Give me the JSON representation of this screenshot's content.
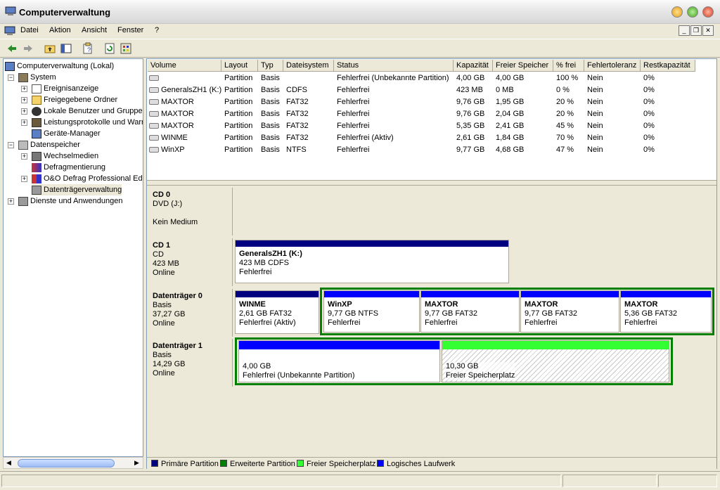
{
  "window": {
    "title": "Computerverwaltung"
  },
  "menu": [
    "Datei",
    "Aktion",
    "Ansicht",
    "Fenster",
    "?"
  ],
  "toolbar_icons": [
    "back-icon",
    "forward-icon",
    "up-folder-icon",
    "show-tree-icon",
    "properties-icon",
    "refresh-icon",
    "settings-icon"
  ],
  "tree": {
    "root": "Computerverwaltung (Lokal)",
    "system": "System",
    "system_items": [
      "Ereignisanzeige",
      "Freigegebene Ordner",
      "Lokale Benutzer und Gruppen",
      "Leistungsprotokolle und Warnungen",
      "Geräte-Manager"
    ],
    "storage": "Datenspeicher",
    "storage_items": [
      "Wechselmedien",
      "Defragmentierung",
      "O&O Defrag Professional Edition",
      "Datenträgerverwaltung"
    ],
    "services": "Dienste und Anwendungen"
  },
  "volumes": {
    "columns": [
      "Volume",
      "Layout",
      "Typ",
      "Dateisystem",
      "Status",
      "Kapazität",
      "Freier Speicher",
      "% frei",
      "Fehlertoleranz",
      "Restkapazität"
    ],
    "rows": [
      [
        "",
        "Partition",
        "Basis",
        "",
        "Fehlerfrei (Unbekannte Partition)",
        "4,00 GB",
        "4,00 GB",
        "100 %",
        "Nein",
        "0%"
      ],
      [
        "GeneralsZH1 (K:)",
        "Partition",
        "Basis",
        "CDFS",
        "Fehlerfrei",
        "423 MB",
        "0 MB",
        "0 %",
        "Nein",
        "0%"
      ],
      [
        "MAXTOR",
        "Partition",
        "Basis",
        "FAT32",
        "Fehlerfrei",
        "9,76 GB",
        "1,95 GB",
        "20 %",
        "Nein",
        "0%"
      ],
      [
        "MAXTOR",
        "Partition",
        "Basis",
        "FAT32",
        "Fehlerfrei",
        "9,76 GB",
        "2,04 GB",
        "20 %",
        "Nein",
        "0%"
      ],
      [
        "MAXTOR",
        "Partition",
        "Basis",
        "FAT32",
        "Fehlerfrei",
        "5,35 GB",
        "2,41 GB",
        "45 %",
        "Nein",
        "0%"
      ],
      [
        "WINME",
        "Partition",
        "Basis",
        "FAT32",
        "Fehlerfrei (Aktiv)",
        "2,61 GB",
        "1,84 GB",
        "70 %",
        "Nein",
        "0%"
      ],
      [
        "WinXP",
        "Partition",
        "Basis",
        "NTFS",
        "Fehlerfrei",
        "9,77 GB",
        "4,68 GB",
        "47 %",
        "Nein",
        "0%"
      ]
    ]
  },
  "disks": {
    "cd0": {
      "name": "CD 0",
      "lines": [
        "DVD (J:)",
        "",
        "Kein Medium"
      ]
    },
    "cd1": {
      "name": "CD 1",
      "lines": [
        "CD",
        "423 MB",
        "Online"
      ],
      "part": {
        "title": "GeneralsZH1  (K:)",
        "l1": "423 MB CDFS",
        "l2": "Fehlerfrei"
      }
    },
    "disk0": {
      "name": "Datenträger 0",
      "lines": [
        "Basis",
        "37,27 GB",
        "Online"
      ],
      "parts": [
        {
          "title": "WINME",
          "l1": "2,61 GB FAT32",
          "l2": "Fehlerfrei (Aktiv)"
        },
        {
          "title": "WinXP",
          "l1": "9,77 GB NTFS",
          "l2": "Fehlerfrei"
        },
        {
          "title": "MAXTOR",
          "l1": "9,77 GB FAT32",
          "l2": "Fehlerfrei"
        },
        {
          "title": "MAXTOR",
          "l1": "9,77 GB FAT32",
          "l2": "Fehlerfrei"
        },
        {
          "title": "MAXTOR",
          "l1": "5,36 GB FAT32",
          "l2": "Fehlerfrei"
        }
      ]
    },
    "disk1": {
      "name": "Datenträger 1",
      "lines": [
        "Basis",
        "14,29 GB",
        "Online"
      ],
      "parts": [
        {
          "l1": "4,00 GB",
          "l2": "Fehlerfrei (Unbekannte Partition)"
        },
        {
          "l1": "10,30 GB",
          "l2": "Freier Speicherplatz"
        }
      ]
    }
  },
  "legend": [
    "Primäre Partition",
    "Erweiterte Partition",
    "Freier Speicherplatz",
    "Logisches Laufwerk"
  ],
  "colors": {
    "primary": "#000080",
    "extended": "#008000",
    "free": "#33ff33",
    "logical": "#0000ff",
    "titlebar": "#e9e9e9"
  }
}
